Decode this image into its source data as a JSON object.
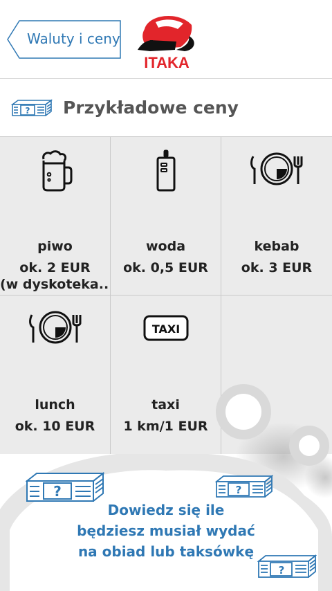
{
  "header": {
    "back_label": "Waluty i ceny",
    "logo_text": "ITAKA"
  },
  "section": {
    "title": "Przykładowe ceny",
    "icon": "money-stack-icon"
  },
  "items": [
    {
      "name": "piwo",
      "price": "ok. 2 EUR",
      "note": "(w dyskoteka...",
      "icon": "beer-mug-icon"
    },
    {
      "name": "woda",
      "price": "ok. 0,5 EUR",
      "icon": "water-bottle-icon"
    },
    {
      "name": "kebab",
      "price": "ok. 3 EUR",
      "icon": "plate-cutlery-icon"
    },
    {
      "name": "lunch",
      "price": "ok. 10 EUR",
      "icon": "plate-cutlery-icon"
    },
    {
      "name": "taxi",
      "price": "1 km/1 EUR",
      "icon": "taxi-sign-icon",
      "taxi_sign": "TAXI"
    }
  ],
  "promo": {
    "line1": "Dowiedz się ile",
    "line2": "będziesz musiał wydać",
    "line3": "na obiad lub taksówkę"
  },
  "colors": {
    "accent_blue": "#2f78b4",
    "logo_red": "#e2252b",
    "grid_bg": "#ebebeb"
  }
}
